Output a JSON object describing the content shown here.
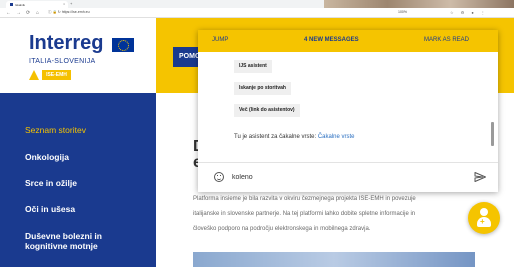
{
  "browser": {
    "tab_title": "Iskalnik",
    "tab_close": "×",
    "tab_new": "+",
    "nav_back": "←",
    "nav_forward": "→",
    "nav_reload": "⟳",
    "nav_home": "⌂",
    "url": "ⓘ 🔒 ↻ https://ise-emh.eu",
    "zoom": "100%",
    "right_icons": "☆ ⚙ ● ⋮"
  },
  "header": {
    "logo_word": "Interreg",
    "logo_sub": "ITALIA-SLOVENIJA",
    "logo_badge": "ISE-EMH",
    "nav_button": "POMO"
  },
  "sidebar": {
    "items": [
      {
        "label": "Seznam storitev",
        "active": true
      },
      {
        "label": "Onkologija"
      },
      {
        "label": "Srce in ožilje"
      },
      {
        "label": "Oči in ušesa"
      },
      {
        "label": "Duševne bolezni in"
      },
      {
        "label": "kognitivne motnje"
      }
    ]
  },
  "main": {
    "heading_line1": "D",
    "heading_line2": "e",
    "paragraph_lines": [
      "Platforma insieme je bila razvita v okviru čezmejnega projekta ISE-EMH in povezuje",
      "italijanske in slovenske partnerje. Na tej platformi lahko dobite spletne informacije in",
      "človeško podporo na področju elektronskega in mobilnega zdravja."
    ]
  },
  "chat": {
    "jump_label": "JUMP",
    "new_messages_label": "4 NEW MESSAGES",
    "mark_read_label": "MARK AS READ",
    "options": [
      "IJS asistent",
      "Iskanje po storitvah",
      "Več (link do asistentov)"
    ],
    "message_prefix": "Tu je asistent za čakalne vrste: ",
    "message_link": "Čakalne vrste",
    "input_value": "koleno",
    "input_placeholder": ""
  },
  "colors": {
    "brand_blue": "#1a3a8f",
    "brand_yellow": "#f5c400",
    "link_blue": "#2a6fc1"
  },
  "icons": [
    "emoji-icon",
    "send-icon",
    "assistant-icon",
    "eu-flag-icon"
  ]
}
